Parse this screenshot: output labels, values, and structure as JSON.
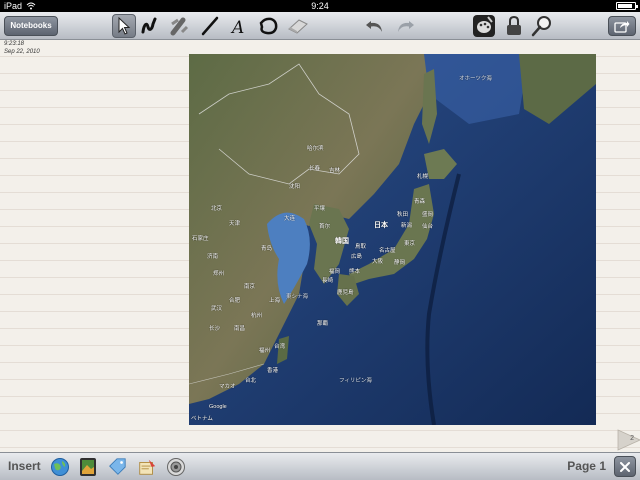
{
  "status_bar": {
    "device": "iPad",
    "time": "9:24"
  },
  "toolbar": {
    "notebooks_label": "Notebooks",
    "tools": [
      {
        "icon": "pointer-arrow-icon",
        "selected": true
      },
      {
        "icon": "freehand-pen-icon"
      },
      {
        "icon": "highlighter-icon"
      },
      {
        "icon": "line-icon"
      },
      {
        "icon": "text-tool-icon",
        "glyph": "A"
      },
      {
        "icon": "shape-tool-icon"
      },
      {
        "icon": "eraser-icon"
      }
    ],
    "history": [
      {
        "icon": "undo-icon"
      },
      {
        "icon": "redo-icon"
      }
    ],
    "options": [
      {
        "icon": "palette-icon"
      },
      {
        "icon": "lock-icon"
      },
      {
        "icon": "magnifier-icon"
      }
    ],
    "share_icon": "share-icon"
  },
  "note": {
    "time": "9:23:18",
    "date": "Sep 22, 2010"
  },
  "map": {
    "labels": [
      {
        "text": "オホーツク海",
        "kind": "sea"
      },
      {
        "text": "日本",
        "kind": "big"
      },
      {
        "text": "札幌"
      },
      {
        "text": "青森"
      },
      {
        "text": "秋田"
      },
      {
        "text": "盛岡"
      },
      {
        "text": "新潟"
      },
      {
        "text": "仙台"
      },
      {
        "text": "東京"
      },
      {
        "text": "名古屋"
      },
      {
        "text": "大阪"
      },
      {
        "text": "静岡"
      },
      {
        "text": "広島"
      },
      {
        "text": "鳥取"
      },
      {
        "text": "福岡"
      },
      {
        "text": "熊本"
      },
      {
        "text": "長崎"
      },
      {
        "text": "鹿児島"
      },
      {
        "text": "韓国",
        "kind": "big"
      },
      {
        "text": "北京"
      },
      {
        "text": "天津"
      },
      {
        "text": "大连"
      },
      {
        "text": "沈阳"
      },
      {
        "text": "哈尔滨"
      },
      {
        "text": "长春"
      },
      {
        "text": "吉林"
      },
      {
        "text": "平壤"
      },
      {
        "text": "首尔"
      },
      {
        "text": "石家庄"
      },
      {
        "text": "济南"
      },
      {
        "text": "青岛"
      },
      {
        "text": "郑州"
      },
      {
        "text": "南京"
      },
      {
        "text": "上海"
      },
      {
        "text": "合肥"
      },
      {
        "text": "杭州"
      },
      {
        "text": "武汉"
      },
      {
        "text": "长沙"
      },
      {
        "text": "南昌"
      },
      {
        "text": "福州"
      },
      {
        "text": "台湾"
      },
      {
        "text": "台北"
      },
      {
        "text": "香港"
      },
      {
        "text": "マカオ"
      },
      {
        "text": "東シナ海",
        "kind": "sea"
      },
      {
        "text": "那覇"
      },
      {
        "text": "フィリピン海",
        "kind": "sea"
      },
      {
        "text": "ベトナム"
      },
      {
        "text": "Google"
      }
    ]
  },
  "page_corner": {
    "number": "2"
  },
  "bottom_bar": {
    "insert_label": "Insert",
    "insert_items": [
      {
        "icon": "globe-icon"
      },
      {
        "icon": "photo-icon"
      },
      {
        "icon": "tag-icon"
      },
      {
        "icon": "clipboard-icon"
      },
      {
        "icon": "speaker-icon"
      }
    ],
    "page_label": "Page 1",
    "close_icon": "close-icon"
  }
}
